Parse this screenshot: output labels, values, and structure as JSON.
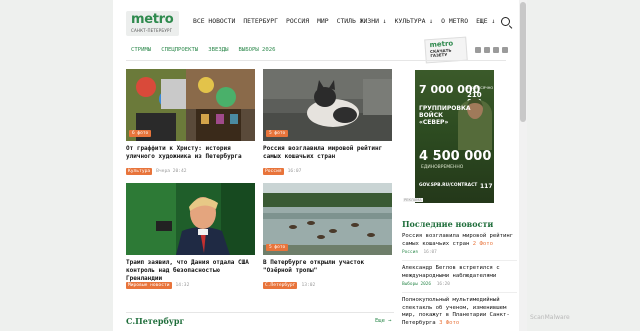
{
  "logo": {
    "word": "metro",
    "sub": "САНКТ-ПЕТЕРБУРГ"
  },
  "nav": [
    "ВСЕ НОВОСТИ",
    "ПЕТЕРБУРГ",
    "РОССИЯ",
    "МИР",
    "СТИЛЬ ЖИЗНИ ↓",
    "КУЛЬТУРА ↓",
    "О METRO",
    "ЕЩЕ ↓"
  ],
  "subnav": [
    "СТРИМЫ",
    "СПЕЦПРОЕКТЫ",
    "ЗВЕЗДЫ",
    "ВЫБОРЫ 2026"
  ],
  "promo": {
    "brand": "metro",
    "line1": "СКАЧАТЬ",
    "line2": "ГАЗЕТУ"
  },
  "cards": [
    {
      "count": "6 фото",
      "title": "От граффити к Христу: история уличного художника из Петербурга",
      "tag": "Культура",
      "time": "Вчера 20:42"
    },
    {
      "count": "5 фото",
      "title": "Россия возглавила мировой рейтинг самых кошачьих стран",
      "tag": "Россия",
      "time": "16:07"
    },
    {
      "count": "",
      "title": "Трамп заявил, что Дания отдала США контроль над безопасностью Гренландии",
      "tag": "Мировые новости",
      "time": "14:32"
    },
    {
      "count": "5 фото",
      "title": "В Петербурге открыли участок \"Озёрной тропы\"",
      "tag": "С.Петербург",
      "time": "13:02"
    }
  ],
  "ad": {
    "sum1": "7 000 000",
    "sum2_label": "ЕЖЕМЕСЯЧНО",
    "sum2": "210 000",
    "group": "ГРУППИРОВКА ВОЙСК «СЕВЕР»",
    "sum3": "4 500 000",
    "sum3_label": "ЕДИНОВРЕМЕННО",
    "site": "GOV.SPB.RU/CONTRACT",
    "phone": "117",
    "label": "РЕКЛАМА"
  },
  "latest": {
    "heading": "Последние новости",
    "items": [
      {
        "text": "Россия возглавила мировой рейтинг самых кошачьих стран",
        "photo": "2 Фото",
        "cat": "Россия",
        "time": "16:07"
      },
      {
        "text": "Александр Беглов встретился с международными наблюдателями",
        "photo": "",
        "cat": "Выборы 2026",
        "time": "16:20"
      },
      {
        "text": "Полнокупольный мультимедийный спектакль об ученом, изменившем мир, покажут в Планетарии Санкт-Петербурга",
        "photo": "3 Фото",
        "cat": "",
        "time": ""
      }
    ]
  },
  "section": {
    "title": "С.Петербург",
    "more": "Еще →"
  },
  "watermark": "ScanMalware"
}
